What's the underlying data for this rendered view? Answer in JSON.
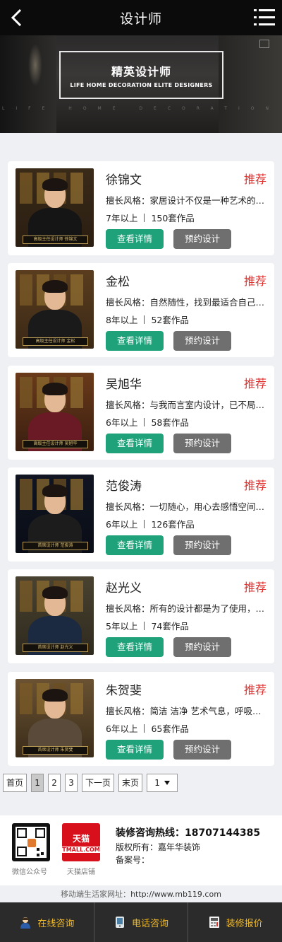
{
  "header": {
    "title": "设计师",
    "back_icon": "back-arrow-icon",
    "menu_icon": "menu-icon"
  },
  "banner": {
    "title_cn": "精英设计师",
    "title_en": "LIFE HOME DECORATION ELITE DESIGNERS",
    "strip_text": "LIFE HOME DECORATION"
  },
  "designers": [
    {
      "name": "徐锦文",
      "tag": "推荐",
      "style": "擅长风格：家居设计不仅是一种艺术的再现",
      "experience": "7年以上",
      "works": "150套作品",
      "detail_label": "查看详情",
      "book_label": "预约设计",
      "plaque": "高级主任设计师  徐锦文"
    },
    {
      "name": "金松",
      "tag": "推荐",
      "style": "擅长风格：自然随性，找到最适合自己家的风格",
      "experience": "8年以上",
      "works": "52套作品",
      "detail_label": "查看详情",
      "book_label": "预约设计",
      "plaque": "高级主任设计师  金松"
    },
    {
      "name": "吴旭华",
      "tag": "推荐",
      "style": "擅长风格：与我而言室内设计，已不局限于空间",
      "experience": "6年以上",
      "works": "58套作品",
      "detail_label": "查看详情",
      "book_label": "预约设计",
      "plaque": "高级主任设计师  吴旭华"
    },
    {
      "name": "范俊涛",
      "tag": "推荐",
      "style": "擅长风格：一切随心，用心去感悟空间；感受生活",
      "experience": "6年以上",
      "works": "126套作品",
      "detail_label": "查看详情",
      "book_label": "预约设计",
      "plaque": "首席设计师  范俊涛"
    },
    {
      "name": "赵光义",
      "tag": "推荐",
      "style": "擅长风格：所有的设计都是为了使用，室内设计",
      "experience": "5年以上",
      "works": "74套作品",
      "detail_label": "查看详情",
      "book_label": "预约设计",
      "plaque": "首席设计师  赵光义"
    },
    {
      "name": "朱贺斐",
      "tag": "推荐",
      "style": "擅长风格：简洁 洁净 艺术气息，呼吸开阔的空间",
      "experience": "6年以上",
      "works": "65套作品",
      "detail_label": "查看详情",
      "book_label": "预约设计",
      "plaque": "首席设计师  朱贺斐"
    }
  ],
  "pager": {
    "first": "首页",
    "pages": [
      "1",
      "2",
      "3"
    ],
    "next": "下一页",
    "last": "末页",
    "select_value": "1"
  },
  "footer": {
    "wechat_caption": "微信公众号",
    "tmall_caption": "天猫店铺",
    "tmall_logo_cn": "天猫",
    "tmall_logo_en": "TMALL.COM",
    "hotline": "装修咨询热线：18707144385",
    "copyright": "版权所有：嘉年华装饰",
    "icp": "备案号："
  },
  "mobile_url": {
    "label": "移动端生活家网址：",
    "url": "http://www.mb119.com"
  },
  "bottom_bar": [
    {
      "label": "在线咨询",
      "icon": "person-icon"
    },
    {
      "label": "电话咨询",
      "icon": "phone-icon"
    },
    {
      "label": "装修报价",
      "icon": "calculator-icon"
    }
  ],
  "colors": {
    "accent_green": "#1fa27a",
    "button_gray": "#6f6f6f",
    "tag_red": "#e0312f",
    "bottom_bar_text": "#f0b929"
  }
}
